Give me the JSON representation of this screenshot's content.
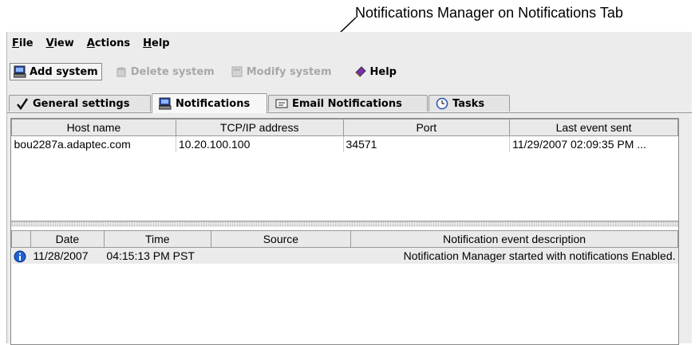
{
  "callout": "Notifications Manager on Notifications Tab",
  "menu": {
    "file": {
      "key": "F",
      "rest": "ile"
    },
    "view": {
      "key": "V",
      "rest": "iew"
    },
    "actions": {
      "key": "A",
      "rest": "ctions"
    },
    "help": {
      "key": "H",
      "rest": "elp"
    }
  },
  "toolbar": {
    "add_system": "Add system",
    "delete_system": "Delete system",
    "modify_system": "Modify system",
    "help": "Help"
  },
  "tabs": {
    "general": "General settings",
    "notifications": "Notifications",
    "email": "Email Notifications",
    "tasks": "Tasks"
  },
  "systems_table": {
    "headers": [
      "Host name",
      "TCP/IP address",
      "Port",
      "Last event sent"
    ],
    "rows": [
      [
        "bou2287a.adaptec.com",
        "10.20.100.100",
        "34571",
        "11/29/2007 02:09:35 PM ..."
      ]
    ]
  },
  "events_table": {
    "headers": [
      "Date",
      "Time",
      "Source",
      "Notification event description"
    ],
    "rows": [
      {
        "date": "11/28/2007",
        "time": "04:15:13 PM PST",
        "source": "",
        "description": "Notification Manager started with notifications Enabled."
      }
    ]
  },
  "colors": {
    "info": "#1f5fd0",
    "selected_row": "#ebebeb"
  }
}
